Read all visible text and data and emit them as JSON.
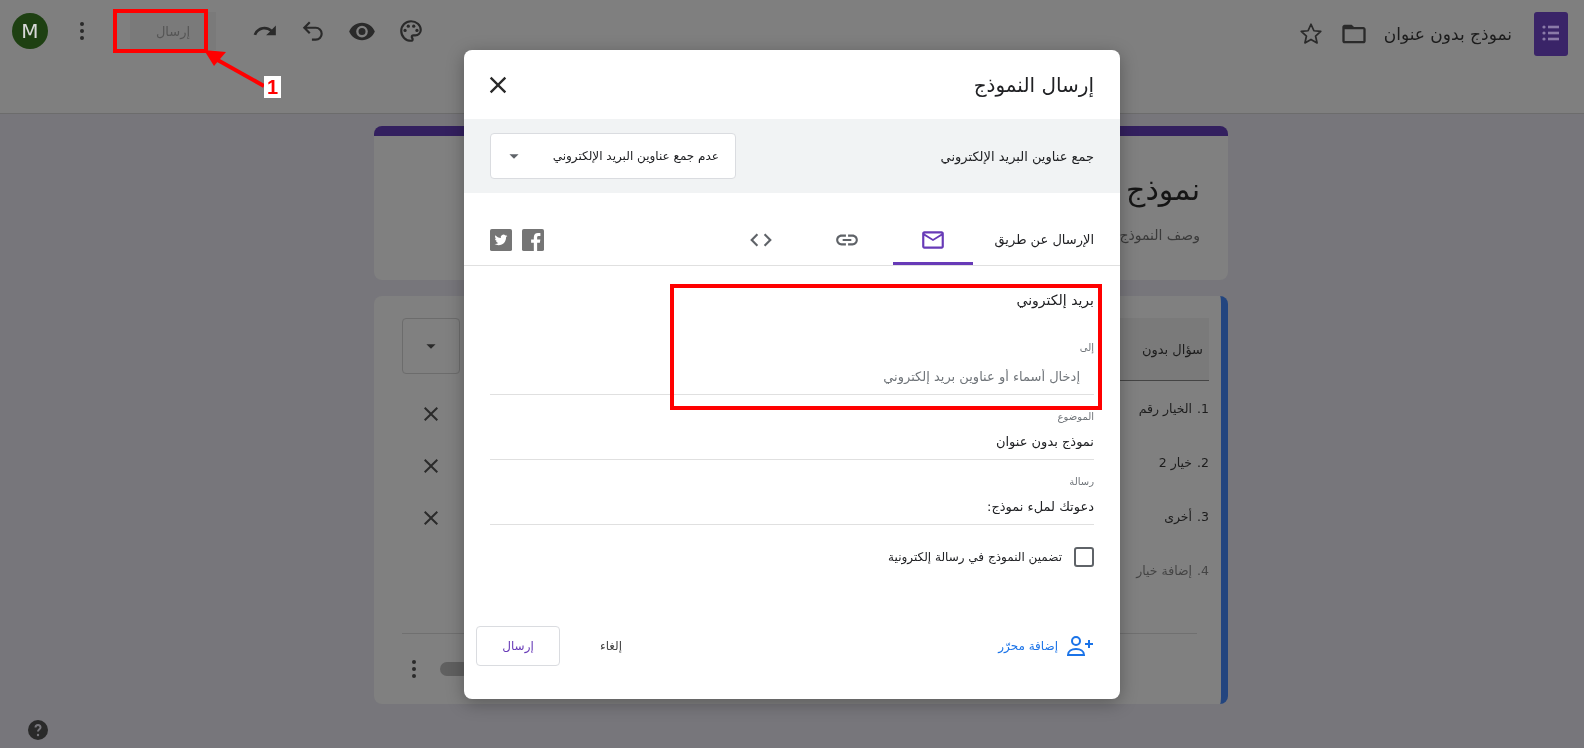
{
  "toolbar": {
    "avatar": "M",
    "send_button": "إرسال",
    "title": "نموذج بدون عنوان"
  },
  "annotation": {
    "number": "1"
  },
  "form": {
    "title": "نموذج",
    "description": "وصف النموذج",
    "question": {
      "title": "سؤال بدون",
      "options": [
        {
          "kind": "option",
          "number": "1.",
          "label": "الخيار رقم"
        },
        {
          "kind": "option",
          "number": "2.",
          "label": "خيار 2"
        },
        {
          "kind": "option",
          "number": "3.",
          "label": "أخرى"
        },
        {
          "kind": "add",
          "number": "4.",
          "label": "إضافة خيار"
        }
      ],
      "required": {
        "on": false
      }
    }
  },
  "dialog": {
    "title": "إرسال النموذج",
    "collect_emails": {
      "label": "جمع عناوين البريد الإلكتروني",
      "value": "عدم جمع عناوين البريد الإلكتروني"
    },
    "send_via": {
      "label": "الإرسال عن طريق",
      "tabs": [
        {
          "kind": "email",
          "selected": true
        },
        {
          "kind": "link",
          "selected": false
        },
        {
          "kind": "embed",
          "selected": false
        }
      ],
      "social": [
        {
          "kind": "facebook"
        },
        {
          "kind": "twitter"
        }
      ]
    },
    "email": {
      "heading": "بريد إلكتروني",
      "to": {
        "label": "إلى",
        "placeholder": "إدخال أسماء أو عناوين بريد إلكتروني"
      },
      "subject": {
        "label": "الموضوع",
        "value": "نموذج بدون عنوان"
      },
      "message": {
        "label": "رسالة",
        "value": "دعوتك لملء نموذج:"
      },
      "include_form": {
        "label": "تضمين النموذج في رسالة إلكترونية",
        "checked": false
      }
    },
    "add_collaborators": "إضافة محرّر",
    "cancel": "إلغاء",
    "send": "إرسال"
  }
}
